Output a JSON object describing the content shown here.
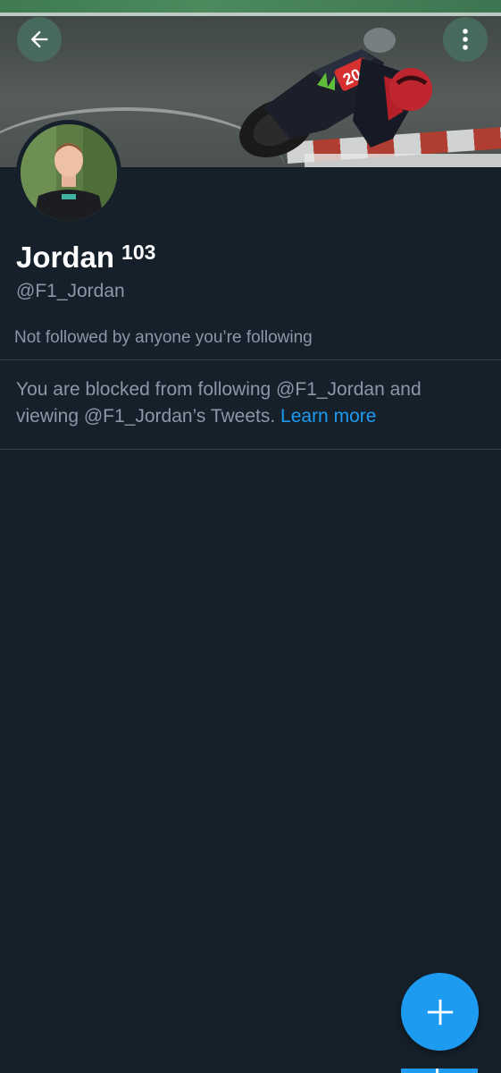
{
  "header": {
    "back_icon": "arrow-left-icon",
    "more_icon": "more-vertical-icon"
  },
  "profile": {
    "name": "Jordan",
    "name_superscript": "103",
    "handle": "@F1_Jordan",
    "followed_note": "Not followed by anyone you’re following"
  },
  "blocked": {
    "message": "You are blocked from following @F1_Jordan and viewing @F1_Jordan’s Tweets.",
    "link_label": "Learn more"
  },
  "fab": {
    "icon": "plus-icon"
  },
  "colors": {
    "background": "#15202b",
    "accent": "#1d9bf0",
    "secondary_text": "#8b98a5",
    "divider": "#38444d"
  }
}
